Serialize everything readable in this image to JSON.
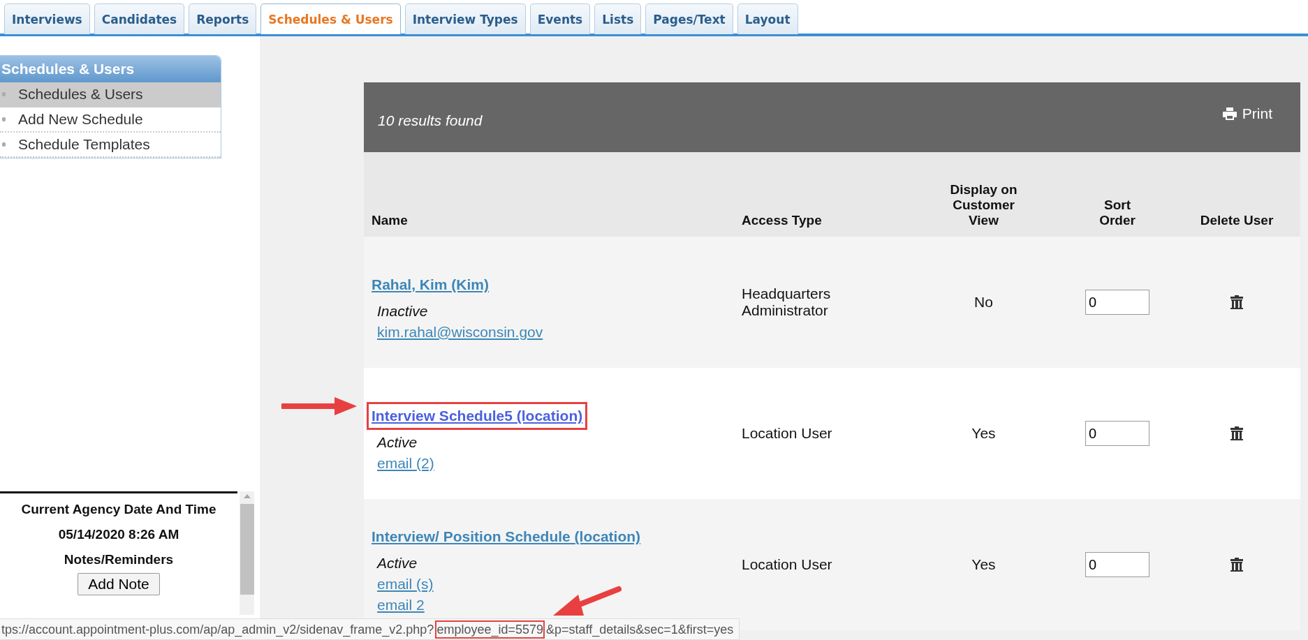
{
  "tabs": [
    {
      "label": "Interviews",
      "selected": false
    },
    {
      "label": "Candidates",
      "selected": false
    },
    {
      "label": "Reports",
      "selected": false
    },
    {
      "label": "Schedules & Users",
      "selected": true
    },
    {
      "label": "Interview Types",
      "selected": false
    },
    {
      "label": "Events",
      "selected": false
    },
    {
      "label": "Lists",
      "selected": false
    },
    {
      "label": "Pages/Text",
      "selected": false
    },
    {
      "label": "Layout",
      "selected": false
    }
  ],
  "sidebar": {
    "title": "Schedules & Users",
    "items": [
      {
        "label": "Schedules & Users",
        "selected": true
      },
      {
        "label": "Add New Schedule",
        "selected": false
      },
      {
        "label": "Schedule Templates",
        "selected": false
      }
    ]
  },
  "agency_panel": {
    "heading": "Current Agency Date And Time",
    "datetime": "05/14/2020 8:26 AM",
    "notes_heading": "Notes/Reminders",
    "button": "Add Note"
  },
  "results": {
    "count": "10 results found",
    "print": "Print"
  },
  "table": {
    "columns": [
      "Name",
      "Access Type",
      "Display on Customer View",
      "Sort Order",
      "Delete User"
    ],
    "rows": [
      {
        "name": "Rahal, Kim (Kim)",
        "highlighted": false,
        "status": "Inactive",
        "emails": [
          "kim.rahal@wisconsin.gov"
        ],
        "access_type": "Headquarters Administrator",
        "display": "No",
        "sort_order": "0"
      },
      {
        "name": "Interview Schedule5 (location)",
        "highlighted": true,
        "status": "Active",
        "emails": [
          "email (2)"
        ],
        "access_type": "Location User",
        "display": "Yes",
        "sort_order": "0"
      },
      {
        "name": "Interview/ Position Schedule (location)",
        "highlighted": false,
        "status": "Active",
        "emails": [
          "email (s)",
          "email 2"
        ],
        "access_type": "Location User",
        "display": "Yes",
        "sort_order": "0"
      }
    ]
  },
  "status_bar": {
    "parts": [
      {
        "text": "tps://account.appointment-plus.com/ap/ap_admin_v2/sidenav_frame_v2.php?",
        "highlighted": false
      },
      {
        "text": "employee_id=5579",
        "highlighted": true
      },
      {
        "text": "&p=staff_details&sec=1&first=yes",
        "highlighted": false
      }
    ]
  }
}
